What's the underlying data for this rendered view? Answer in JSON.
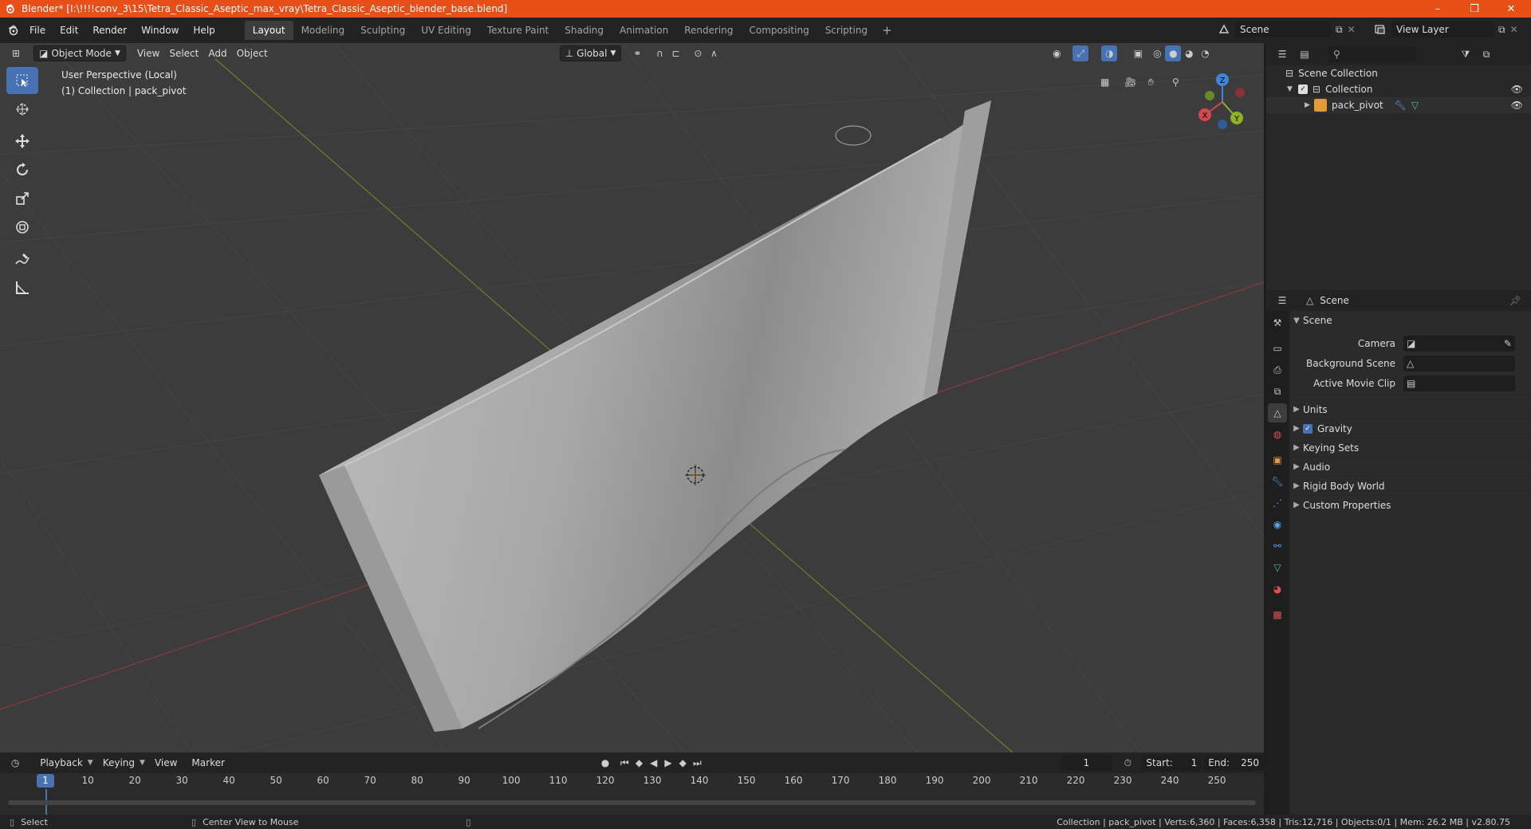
{
  "title": "Blender* [I:\\!!!!conv_3\\15\\Tetra_Classic_Aseptic_max_vray\\Tetra_Classic_Aseptic_blender_base.blend]",
  "window_controls": [
    "–",
    "❐",
    "✕"
  ],
  "menu": [
    "File",
    "Edit",
    "Render",
    "Window",
    "Help"
  ],
  "workspaces": [
    "Layout",
    "Modeling",
    "Sculpting",
    "UV Editing",
    "Texture Paint",
    "Shading",
    "Animation",
    "Rendering",
    "Compositing",
    "Scripting"
  ],
  "scene": "Scene",
  "view_layer": "View Layer",
  "viewport": {
    "mode": "Object Mode",
    "menus": [
      "View",
      "Select",
      "Add",
      "Object"
    ],
    "orientation": "Global",
    "perspective": "User Perspective (Local)",
    "collection_info": "(1) Collection | pack_pivot",
    "gizmo": {
      "x": "X",
      "y": "Y",
      "z": "Z"
    }
  },
  "outliner": {
    "scene_collection": "Scene Collection",
    "collection": "Collection",
    "object": "pack_pivot"
  },
  "properties": {
    "context": "Scene",
    "panel": "Scene",
    "camera_label": "Camera",
    "bg_label": "Background Scene",
    "clip_label": "Active Movie Clip",
    "subpanels": [
      "Units",
      "Gravity",
      "Keying Sets",
      "Audio",
      "Rigid Body World",
      "Custom Properties"
    ]
  },
  "timeline": {
    "menus": [
      "Playback",
      "Keying",
      "View",
      "Marker"
    ],
    "current_frame": "1",
    "start_label": "Start:",
    "start": "1",
    "end_label": "End:",
    "end": "250",
    "ticks": [
      "1",
      "10",
      "20",
      "30",
      "40",
      "50",
      "60",
      "70",
      "80",
      "90",
      "100",
      "110",
      "120",
      "130",
      "140",
      "150",
      "160",
      "170",
      "180",
      "190",
      "200",
      "210",
      "220",
      "230",
      "240",
      "250"
    ]
  },
  "status": {
    "select": "Select",
    "center": "Center View to Mouse",
    "info": "Collection | pack_pivot | Verts:6,360 | Faces:6,358 | Tris:12,716 | Objects:0/1 | Mem: 26.2 MB | v2.80.75"
  },
  "colors": {
    "accent": "#4772b3",
    "titlebar": "#e84e18",
    "x_axis": "#d3484f",
    "y_axis": "#8fb325",
    "z_axis": "#3c86e0"
  }
}
